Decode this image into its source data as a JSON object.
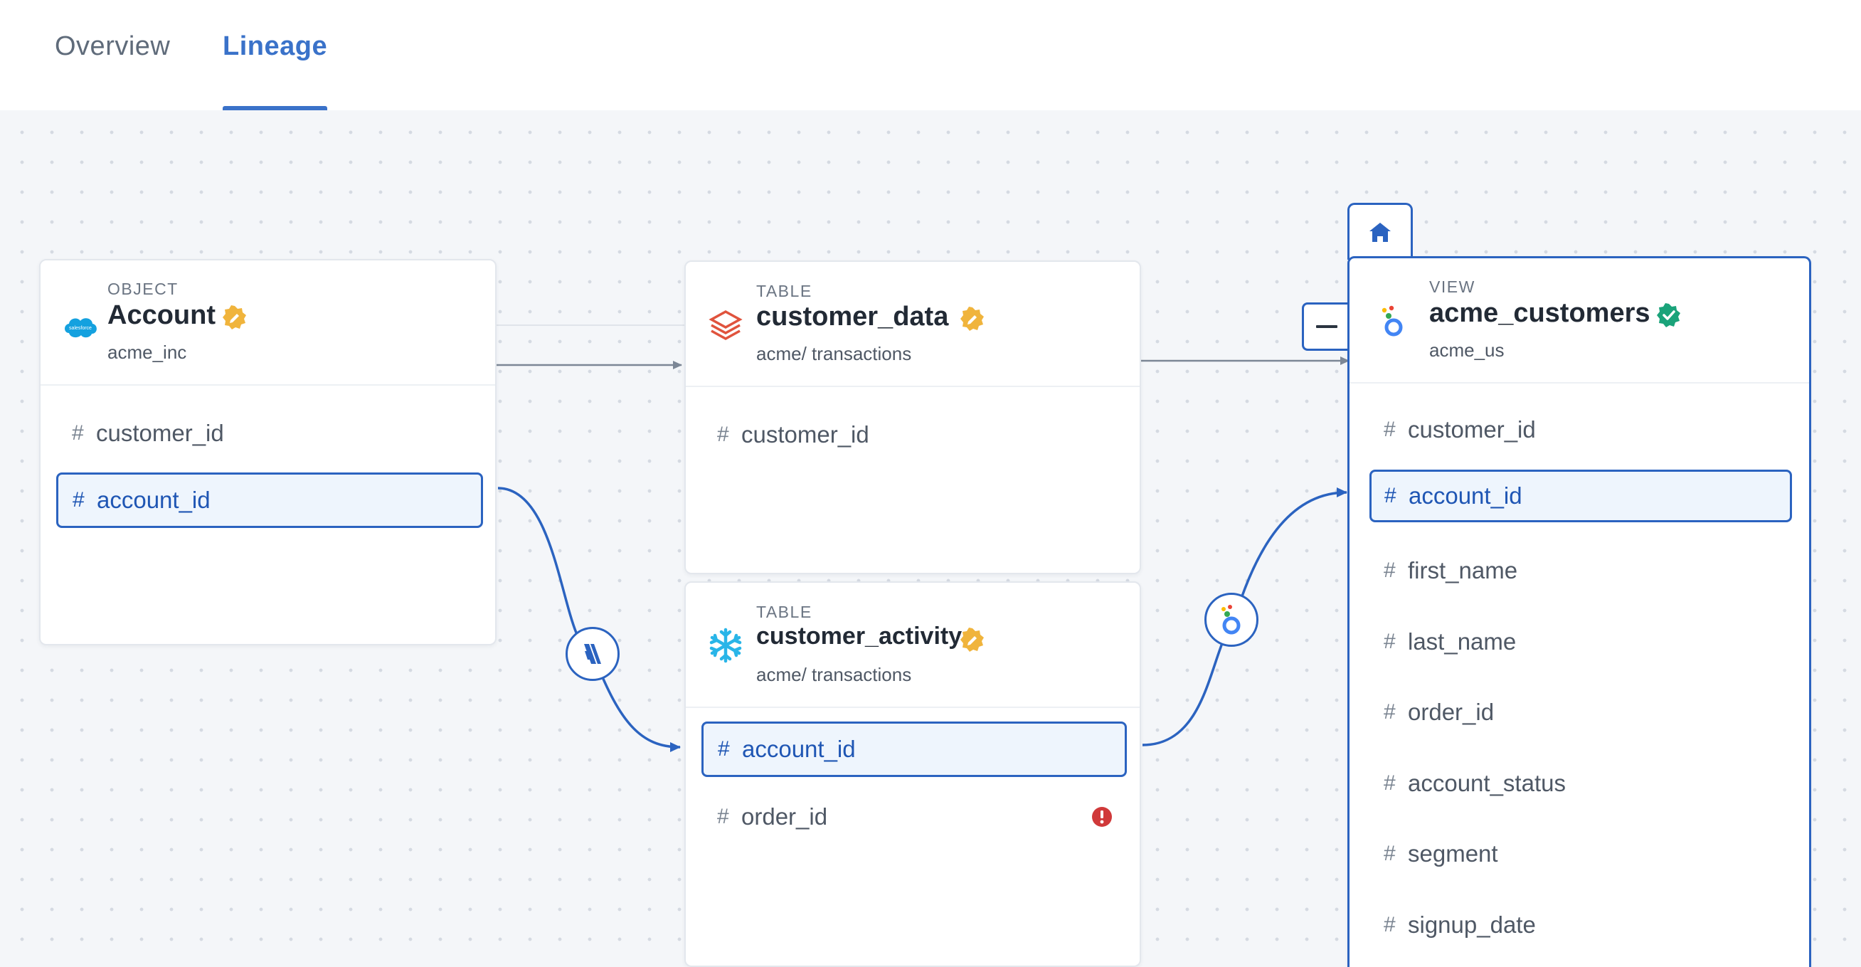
{
  "tabs": [
    {
      "label": "Overview",
      "active": false
    },
    {
      "label": "Lineage",
      "active": true
    }
  ],
  "colors": {
    "accent": "#2b63c0",
    "tab_active": "#3a72c9",
    "badge_orange": "#f0b43c",
    "badge_green": "#1aa37a",
    "error_red": "#d0393a",
    "canvas_bg": "#f4f6f9"
  },
  "nodes": {
    "account": {
      "type": "OBJECT",
      "title": "Account",
      "subtitle": "acme_inc",
      "logo": "salesforce-icon",
      "logo_text": "salesforce",
      "badge": "verified-orange-icon",
      "fields": [
        "customer_id",
        "account_id"
      ],
      "selected_field": "account_id"
    },
    "customer_data": {
      "type": "TABLE",
      "title": "customer_data",
      "subtitle": "acme/ transactions",
      "logo": "databricks-icon",
      "badge": "verified-orange-icon",
      "fields": [
        "customer_id"
      ]
    },
    "customer_activity": {
      "type": "TABLE",
      "title": "customer_activity",
      "subtitle": "acme/ transactions",
      "logo": "snowflake-icon",
      "badge": "verified-orange-icon",
      "fields": [
        "account_id",
        "order_id"
      ],
      "selected_field": "account_id",
      "field_warnings": {
        "order_id": "error-icon"
      }
    },
    "acme_customers": {
      "type": "VIEW",
      "title": "acme_customers",
      "subtitle": "acme_us",
      "logo": "looker-icon",
      "badge": "verified-green-icon",
      "fields": [
        "customer_id",
        "account_id",
        "first_name",
        "last_name",
        "order_id",
        "account_status",
        "segment",
        "signup_date"
      ],
      "selected_field": "account_id",
      "home_icon": "home-icon",
      "collapse_icon": "minus-icon"
    }
  },
  "edges": [
    {
      "from": "account",
      "to": "customer_data",
      "kind": "table"
    },
    {
      "from": "customer_data",
      "to": "acme_customers",
      "kind": "table"
    },
    {
      "from": "account.account_id",
      "to": "customer_activity.account_id",
      "kind": "column",
      "icon": "fivetran-icon"
    },
    {
      "from": "customer_activity.account_id",
      "to": "acme_customers.account_id",
      "kind": "column",
      "icon": "looker-icon"
    }
  ]
}
